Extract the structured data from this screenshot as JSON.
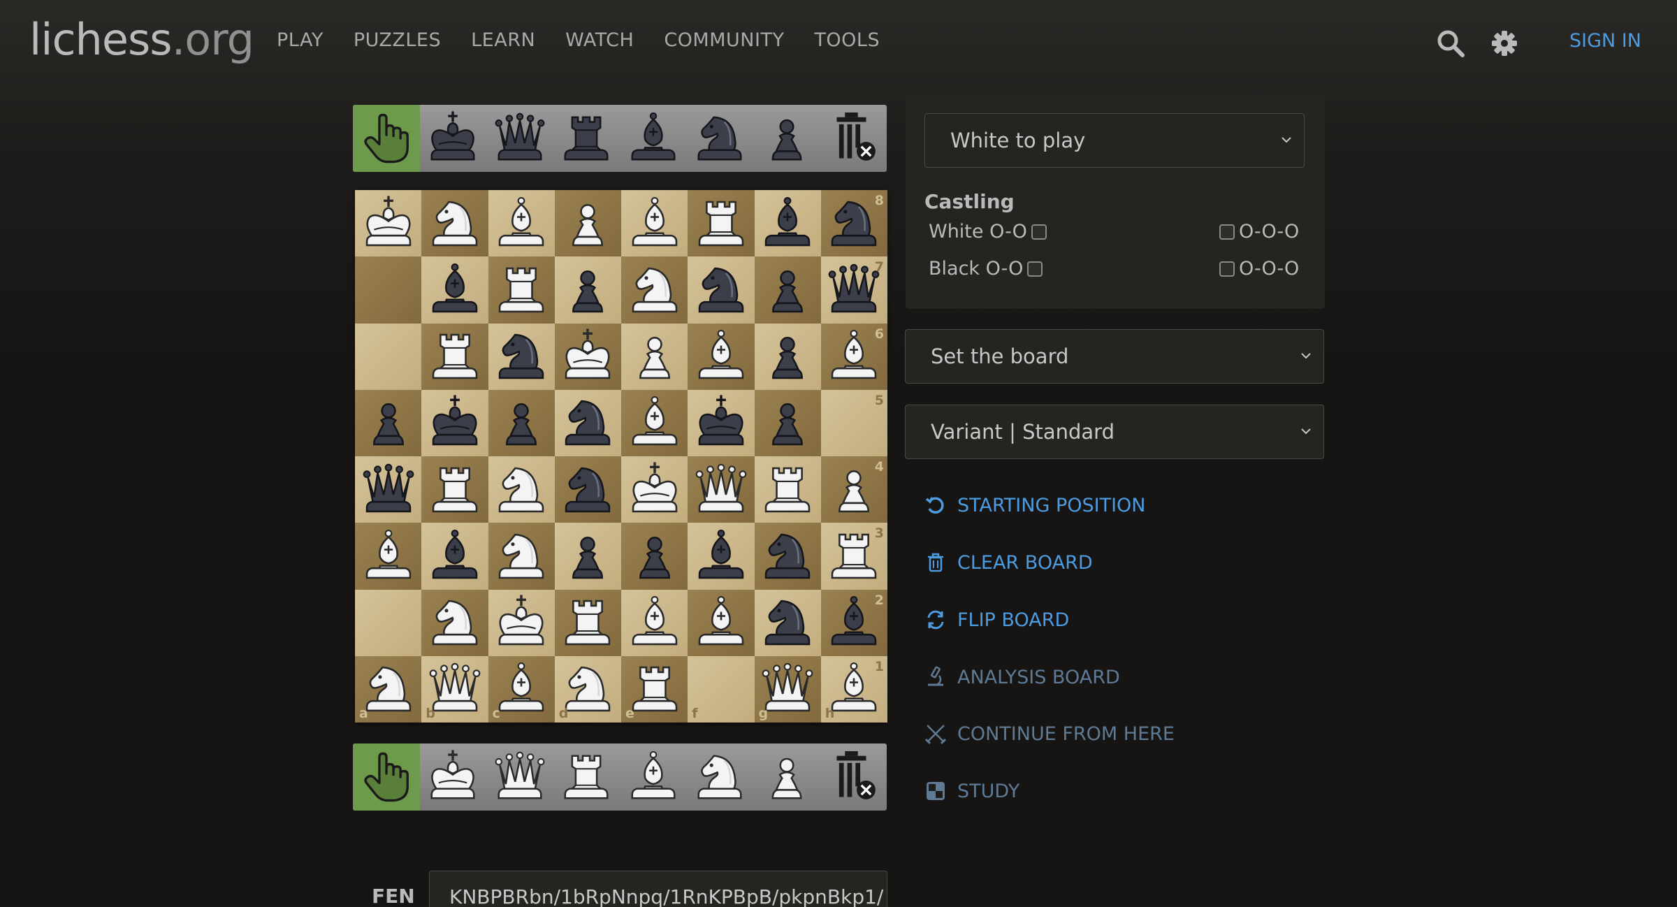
{
  "header": {
    "logo_main": "lichess",
    "logo_tld": ".org",
    "nav": [
      "PLAY",
      "PUZZLES",
      "LEARN",
      "WATCH",
      "COMMUNITY",
      "TOOLS"
    ],
    "signin": "SIGN IN",
    "icons": {
      "search": "search-icon",
      "settings": "gear-icon"
    }
  },
  "banks": {
    "top": [
      "pointer",
      "bk",
      "bq",
      "br",
      "bb",
      "bn",
      "bp",
      "trash"
    ],
    "bottom": [
      "pointer",
      "wk",
      "wq",
      "wr",
      "wb",
      "wn",
      "wp",
      "trash"
    ]
  },
  "board": {
    "rows": [
      [
        "wk",
        "wn",
        "wb",
        "wp",
        "wb",
        "wr",
        "bb",
        "bn"
      ],
      [
        "",
        "bb",
        "wr",
        "bp",
        "wn",
        "bn",
        "bp",
        "bq"
      ],
      [
        "",
        "wr",
        "bn",
        "wk",
        "wp",
        "wb",
        "bp",
        "wb"
      ],
      [
        "bp",
        "bk",
        "bp",
        "bn",
        "wb",
        "bk",
        "bp",
        ""
      ],
      [
        "bq",
        "wr",
        "wn",
        "bn",
        "wk",
        "wq",
        "wr",
        "wp"
      ],
      [
        "wb",
        "bb",
        "wn",
        "bp",
        "bp",
        "bb",
        "bn",
        "wr"
      ],
      [
        "",
        "wn",
        "wk",
        "wr",
        "wb",
        "wb",
        "bn",
        "bb"
      ],
      [
        "wn",
        "wq",
        "wb",
        "wn",
        "wr",
        "",
        "wq",
        "wb"
      ]
    ],
    "ranks": [
      "8",
      "7",
      "6",
      "5",
      "4",
      "3",
      "2",
      "1"
    ],
    "files": [
      "a",
      "b",
      "c",
      "d",
      "e",
      "f",
      "g",
      "h"
    ]
  },
  "panel": {
    "turn_select": "White to play",
    "castling_title": "Castling",
    "white_label": "White O-O",
    "black_label": "Black O-O",
    "long_label": "O-O-O",
    "set_board_select": "Set the board",
    "variant_select": "Variant | Standard"
  },
  "actions": [
    {
      "label": "STARTING POSITION",
      "icon": "reset-icon",
      "state": "active"
    },
    {
      "label": "CLEAR BOARD",
      "icon": "trash-icon",
      "state": "active"
    },
    {
      "label": "FLIP BOARD",
      "icon": "flip-icon",
      "state": "active"
    },
    {
      "label": "ANALYSIS BOARD",
      "icon": "microscope-icon",
      "state": "disabled"
    },
    {
      "label": "CONTINUE FROM HERE",
      "icon": "swords-icon",
      "state": "disabled"
    },
    {
      "label": "STUDY",
      "icon": "study-icon",
      "state": "disabled"
    }
  ],
  "fen": {
    "label": "FEN",
    "value": "KNBPBRbn/1bRpNnpq/1RnKPBpB/pkpnBkp1/"
  },
  "colors": {
    "accent": "#4d9be0",
    "accent_dim": "#5f7a95",
    "pointer_bg": "#6e9a4b",
    "light_square": "#c9b58a",
    "dark_square": "#8e7546"
  }
}
